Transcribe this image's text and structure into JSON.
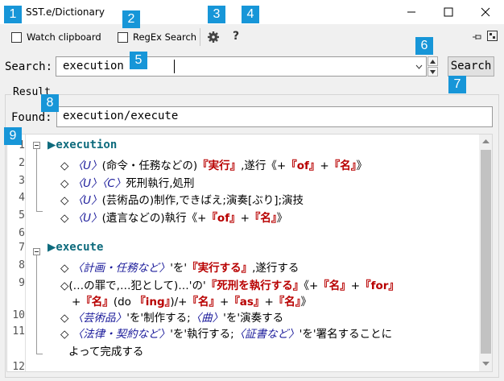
{
  "window": {
    "title": "SST.e/Dictionary"
  },
  "toolbar": {
    "watch_clipboard": "Watch clipboard",
    "regex_search": "RegEx Search",
    "help": "?"
  },
  "search": {
    "label": "Search:",
    "value": "execution",
    "button": "Search"
  },
  "result": {
    "group_label": "Result",
    "found_label": "Found:",
    "found_value": "execution/execute",
    "lines": [
      {
        "no": "1",
        "parts": [
          [
            "▶",
            "tri"
          ],
          [
            "execution",
            "head"
          ]
        ]
      },
      {
        "no": "2",
        "parts": [
          [
            "◇ ",
            ""
          ],
          [
            "〈U〉",
            "blue-i"
          ],
          [
            "(命令・任務などの)",
            ""
          ],
          [
            "『実行』",
            "red"
          ],
          [
            ",遂行《+",
            ""
          ],
          [
            "『of』",
            "red"
          ],
          [
            "+",
            ""
          ],
          [
            "『名』",
            "red"
          ],
          [
            "》",
            ""
          ]
        ]
      },
      {
        "no": "3",
        "parts": [
          [
            "◇ ",
            ""
          ],
          [
            "〈U〉〈C〉",
            "blue-i"
          ],
          [
            "死刑執行,処刑",
            ""
          ]
        ]
      },
      {
        "no": "4",
        "parts": [
          [
            "◇ ",
            ""
          ],
          [
            "〈U〉",
            "blue-i"
          ],
          [
            "(芸術品の)制作,できばえ;演奏[ぶり];演技",
            ""
          ]
        ]
      },
      {
        "no": "5",
        "parts": [
          [
            "◇ ",
            ""
          ],
          [
            "〈U〉",
            "blue-i"
          ],
          [
            "(遺言などの)執行《+",
            ""
          ],
          [
            "『of』",
            "red"
          ],
          [
            "+",
            ""
          ],
          [
            "『名』",
            "red"
          ],
          [
            "》",
            ""
          ]
        ]
      },
      {
        "no": "6",
        "parts": []
      },
      {
        "no": "7",
        "parts": [
          [
            "▶",
            "tri"
          ],
          [
            "execute",
            "head"
          ]
        ]
      },
      {
        "no": "8",
        "parts": [
          [
            "◇ ",
            ""
          ],
          [
            "〈計画・任務など〉",
            "blue-i"
          ],
          [
            "'を'",
            ""
          ],
          [
            "『実行する』",
            "red"
          ],
          [
            ",遂行する",
            ""
          ]
        ]
      },
      {
        "no": "9",
        "parts": [
          [
            "◇(…の罪で,…犯として)…'の'",
            ""
          ],
          [
            "『死刑を執行する』",
            "red"
          ],
          [
            "《+",
            ""
          ],
          [
            "『名』",
            "red"
          ],
          [
            "+",
            ""
          ],
          [
            "『for』",
            "red"
          ]
        ]
      },
      {
        "no": "",
        "parts": [
          [
            "+",
            ""
          ],
          [
            "『名』",
            "red"
          ],
          [
            "(do ",
            ""
          ],
          [
            "『ing』",
            "red"
          ],
          [
            ")/+",
            ""
          ],
          [
            "『名』",
            "red"
          ],
          [
            "+",
            ""
          ],
          [
            "『as』",
            "red"
          ],
          [
            "+",
            ""
          ],
          [
            "『名』",
            "red"
          ],
          [
            "》",
            ""
          ]
        ]
      },
      {
        "no": "10",
        "parts": [
          [
            "◇ ",
            ""
          ],
          [
            "〈芸術品〉",
            "blue-i"
          ],
          [
            "'を'制作する;",
            ""
          ],
          [
            "〈曲〉",
            "blue-i"
          ],
          [
            "'を'演奏する",
            ""
          ]
        ]
      },
      {
        "no": "11",
        "parts": [
          [
            "◇ ",
            ""
          ],
          [
            "〈法律・契約など〉",
            "blue-i"
          ],
          [
            "'を'執行する;",
            ""
          ],
          [
            "〈証書など〉",
            "blue-i"
          ],
          [
            "'を'署名することに",
            ""
          ]
        ]
      },
      {
        "no": "",
        "parts": [
          [
            "よって完成する",
            ""
          ]
        ]
      },
      {
        "no": "12",
        "parts": []
      }
    ]
  },
  "badges": [
    "1",
    "2",
    "3",
    "4",
    "5",
    "6",
    "7",
    "8",
    "9"
  ],
  "colors": {
    "accent": "#1796d8",
    "headword": "#0e6b7d",
    "emphasis": "#b80000",
    "label": "#1a1a9a"
  }
}
